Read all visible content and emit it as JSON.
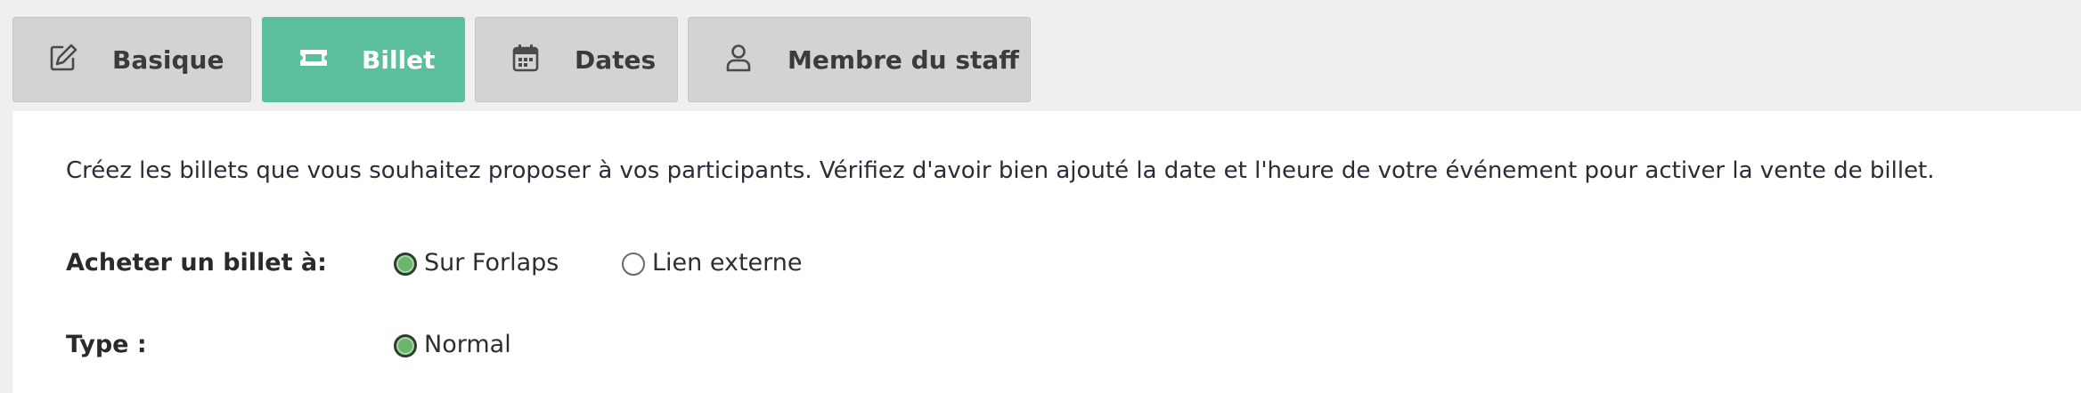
{
  "tabs": [
    {
      "label": "Basique",
      "icon": "edit-icon",
      "active": false
    },
    {
      "label": "Billet",
      "icon": "ticket-icon",
      "active": true
    },
    {
      "label": "Dates",
      "icon": "calendar-icon",
      "active": false
    },
    {
      "label": "Membre du staff",
      "icon": "user-icon",
      "active": false
    }
  ],
  "billet": {
    "intro": "Créez les billets que vous souhaitez proposer à vos participants. Vérifiez d'avoir bien ajouté la date et l'heure de votre événement pour activer la vente de billet.",
    "purchase": {
      "label": "Acheter un billet à:",
      "options": [
        {
          "label": "Sur Forlaps",
          "checked": true
        },
        {
          "label": "Lien externe",
          "checked": false
        }
      ]
    },
    "type": {
      "label": "Type :",
      "options": [
        {
          "label": "Normal",
          "checked": true
        }
      ]
    }
  },
  "colors": {
    "active_tab": "#5bbf9c",
    "inactive_tab": "#d3d3d3",
    "radio_checked": "#6bb56d",
    "page_background": "#efefef",
    "panel_background": "#ffffff"
  }
}
